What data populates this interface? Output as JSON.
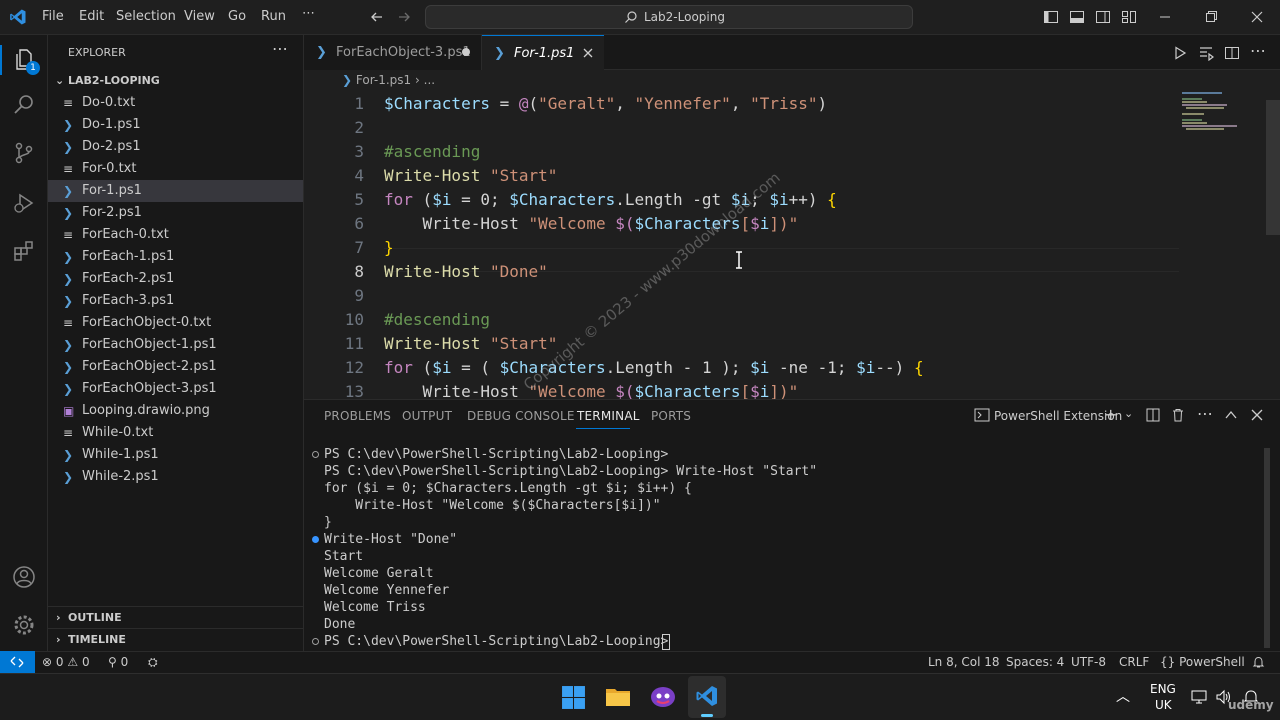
{
  "titlebar": {
    "menus": [
      "File",
      "Edit",
      "Selection",
      "View",
      "Go",
      "Run",
      "..."
    ],
    "search_text": "Lab2-Looping"
  },
  "sidebar": {
    "header": "EXPLORER",
    "folder": "LAB2-LOOPING",
    "files": [
      {
        "name": "Do-0.txt",
        "type": "txt"
      },
      {
        "name": "Do-1.ps1",
        "type": "ps1"
      },
      {
        "name": "Do-2.ps1",
        "type": "ps1"
      },
      {
        "name": "For-0.txt",
        "type": "txt"
      },
      {
        "name": "For-1.ps1",
        "type": "ps1",
        "selected": true
      },
      {
        "name": "For-2.ps1",
        "type": "ps1"
      },
      {
        "name": "ForEach-0.txt",
        "type": "txt"
      },
      {
        "name": "ForEach-1.ps1",
        "type": "ps1"
      },
      {
        "name": "ForEach-2.ps1",
        "type": "ps1"
      },
      {
        "name": "ForEach-3.ps1",
        "type": "ps1"
      },
      {
        "name": "ForEachObject-0.txt",
        "type": "txt"
      },
      {
        "name": "ForEachObject-1.ps1",
        "type": "ps1"
      },
      {
        "name": "ForEachObject-2.ps1",
        "type": "ps1"
      },
      {
        "name": "ForEachObject-3.ps1",
        "type": "ps1"
      },
      {
        "name": "Looping.drawio.png",
        "type": "png"
      },
      {
        "name": "While-0.txt",
        "type": "txt"
      },
      {
        "name": "While-1.ps1",
        "type": "ps1"
      },
      {
        "name": "While-2.ps1",
        "type": "ps1"
      }
    ],
    "outline": "OUTLINE",
    "timeline": "TIMELINE"
  },
  "tabs": [
    {
      "label": "ForEachObject-3.ps1",
      "active": false,
      "modified": true
    },
    {
      "label": "For-1.ps1",
      "active": true
    }
  ],
  "breadcrumb": {
    "file": "For-1.ps1",
    "rest": "..."
  },
  "code_lines": [
    {
      "n": "1",
      "text": "$Characters = @(\"Geralt\", \"Yennefer\", \"Triss\")"
    },
    {
      "n": "2",
      "text": ""
    },
    {
      "n": "3",
      "text": "#ascending"
    },
    {
      "n": "4",
      "text": "Write-Host \"Start\""
    },
    {
      "n": "5",
      "text": "for ($i = 0; $Characters.Length -gt $i; $i++) {"
    },
    {
      "n": "6",
      "text": "    Write-Host \"Welcome $($Characters[$i])\""
    },
    {
      "n": "7",
      "text": "}"
    },
    {
      "n": "8",
      "text": "Write-Host \"Done\""
    },
    {
      "n": "9",
      "text": ""
    },
    {
      "n": "10",
      "text": "#descending"
    },
    {
      "n": "11",
      "text": "Write-Host \"Start\""
    },
    {
      "n": "12",
      "text": "for ($i = ( $Characters.Length - 1 ); $i -ne -1; $i--) {"
    },
    {
      "n": "13",
      "text": "    Write-Host \"Welcome $($Characters[$i])\""
    }
  ],
  "panel": {
    "tabs": [
      "PROBLEMS",
      "OUTPUT",
      "DEBUG CONSOLE",
      "TERMINAL",
      "PORTS"
    ],
    "active_tab": "TERMINAL",
    "terminal_name": "PowerShell Extension",
    "terminal_lines": [
      "PS C:\\dev\\PowerShell-Scripting\\Lab2-Looping>",
      "PS C:\\dev\\PowerShell-Scripting\\Lab2-Looping> Write-Host \"Start\"",
      "for ($i = 0; $Characters.Length -gt $i; $i++) {",
      "    Write-Host \"Welcome $($Characters[$i])\"",
      "}",
      "Write-Host \"Done\"",
      "Start",
      "Welcome Geralt",
      "Welcome Yennefer",
      "Welcome Triss",
      "Done",
      "PS C:\\dev\\PowerShell-Scripting\\Lab2-Looping> "
    ]
  },
  "status": {
    "errors": "0",
    "warnings": "0",
    "ports": "0",
    "position": "Ln 8, Col 18",
    "spaces": "Spaces: 4",
    "encoding": "UTF-8",
    "eol": "CRLF",
    "language": "PowerShell"
  },
  "taskbar": {
    "lang_top": "ENG",
    "lang_bottom": "UK"
  },
  "watermark": "Copyright © 2023 - www.p30download.com",
  "udemy": "udemy",
  "colors": {
    "accent": "#0078d4",
    "keyword": "#c586c0",
    "string": "#ce9178",
    "variable": "#9cdcfe",
    "function": "#dcdcaa",
    "comment": "#6a9955"
  }
}
